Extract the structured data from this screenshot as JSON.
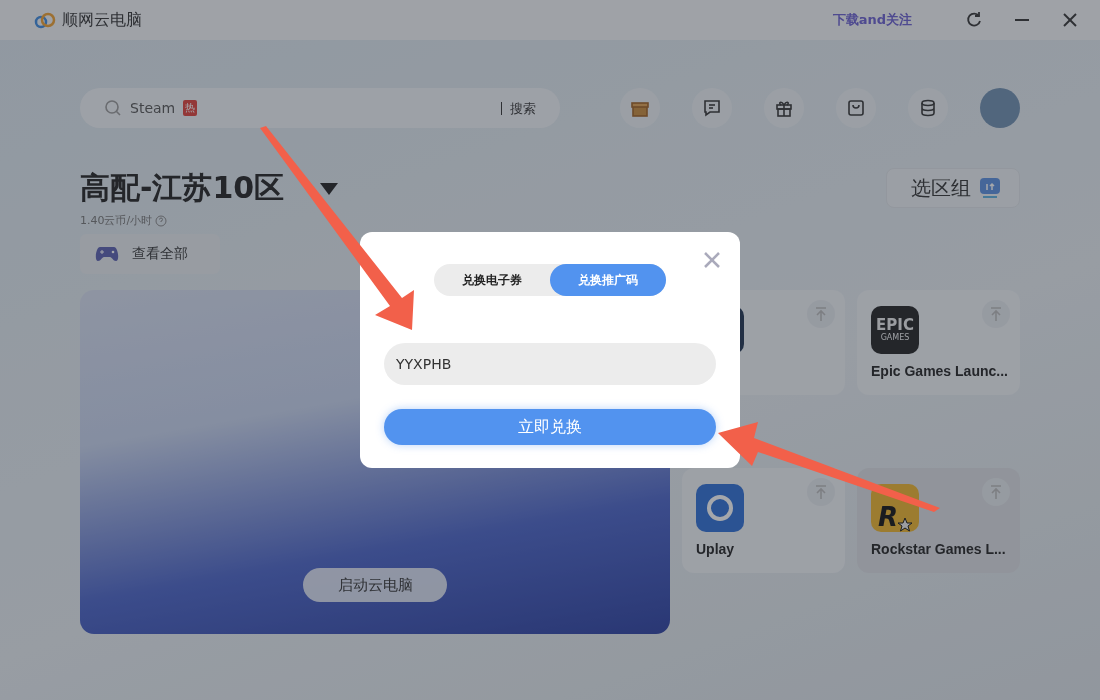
{
  "window": {
    "title": "顺网云电脑",
    "link": "下载and关注"
  },
  "search": {
    "value": "Steam",
    "hot_badge": "热",
    "button": "搜索"
  },
  "server": {
    "name": "高配-江苏10区",
    "price": "1.40云币/小时",
    "view_all": "查看全部",
    "start_button": "启动云电脑"
  },
  "region_button": "选区组",
  "games": [
    {
      "kind": "blank",
      "hovered": false
    },
    {
      "kind": "epic",
      "name": "Epic Games Launc...",
      "logo_text": [
        "EPIC",
        "GAMES"
      ],
      "hovered": false
    },
    {
      "kind": "uplay",
      "name": "Uplay",
      "hovered": false
    },
    {
      "kind": "rockstar",
      "name": "Rockstar Games L...",
      "logo_text": [
        "R"
      ],
      "hovered": true
    }
  ],
  "dialog": {
    "tabs": [
      {
        "label": "兑换电子券",
        "selected": false
      },
      {
        "label": "兑换推广码",
        "selected": true
      }
    ],
    "code_field": {
      "value": "YYXPHB"
    },
    "submit": "立即兑换"
  }
}
